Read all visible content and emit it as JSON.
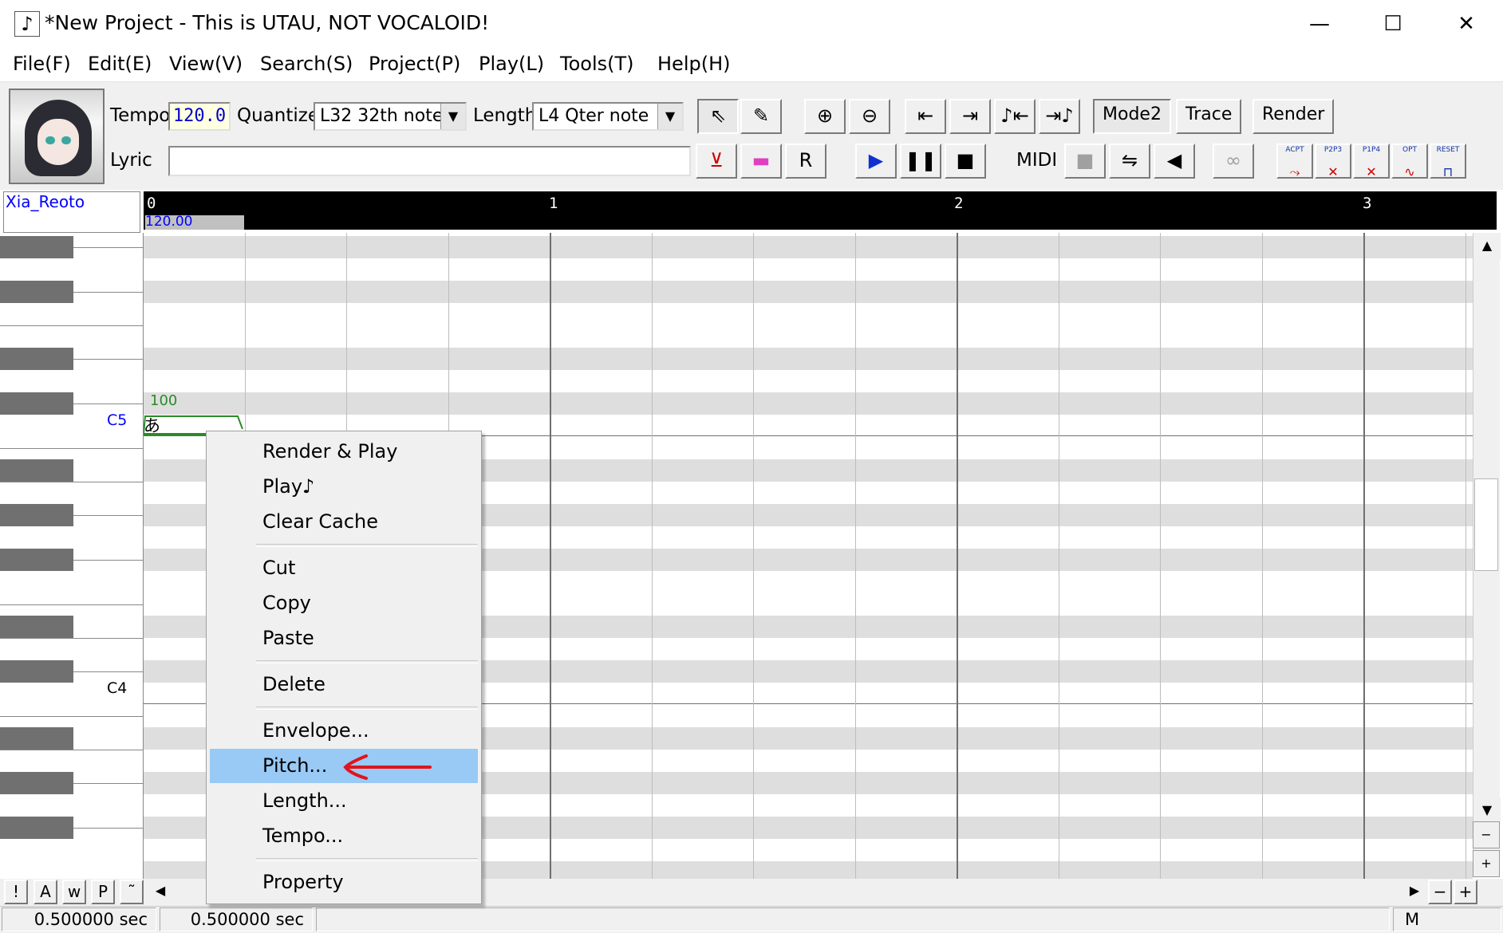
{
  "window": {
    "title": "*New Project - This is UTAU, NOT VOCALOID!",
    "icon": "note-icon",
    "controls": {
      "minimize": "—",
      "maximize": "☐",
      "close": "✕"
    }
  },
  "menu": [
    "File(F)",
    "Edit(E)",
    "View(V)",
    "Search(S)",
    "Project(P)",
    "Play(L)",
    "Tools(T)",
    "Help(H)"
  ],
  "toolbar": {
    "tempo_label": "Tempo",
    "tempo_value": "120.0",
    "quantize_label": "Quantize",
    "quantize_value": "L32 32th note",
    "length_label": "Length",
    "length_value": "L4  Qter note",
    "lyric_label": "Lyric",
    "lyric_value": "",
    "mode2": "Mode2",
    "trace": "Trace",
    "render": "Render",
    "midi_label": "MIDI",
    "tool_labels": {
      "acpt": "ACPT",
      "p2p3": "P2P3",
      "p1p4": "P1P4",
      "opt": "OPT",
      "reset": "RESET"
    }
  },
  "track": {
    "singer": "Xia_Reoto",
    "tempo_marker": "120.00",
    "bars": [
      "0",
      "1",
      "2",
      "3"
    ]
  },
  "keys": {
    "c5": "C5",
    "c4": "C4"
  },
  "note": {
    "lyric": "あ",
    "velocity": "100"
  },
  "bottom_buttons": [
    "!",
    "A",
    "w",
    "P",
    "˜"
  ],
  "zoom_buttons": {
    "minus": "−",
    "plus": "+"
  },
  "status": {
    "pos1": "0.500000 sec",
    "pos2": "0.500000 sec",
    "mode": "M"
  },
  "context_menu": {
    "render_play": "Render & Play",
    "play": "Play♪",
    "clear_cache": "Clear Cache",
    "cut": "Cut",
    "copy": "Copy",
    "paste": "Paste",
    "delete": "Delete",
    "envelope": "Envelope...",
    "pitch": "Pitch...",
    "length": "Length...",
    "tempo": "Tempo...",
    "property": "Property"
  },
  "colors": {
    "highlight": "#99c9f5",
    "annotation_arrow": "#e0141c",
    "note": "#2a8a2a"
  }
}
